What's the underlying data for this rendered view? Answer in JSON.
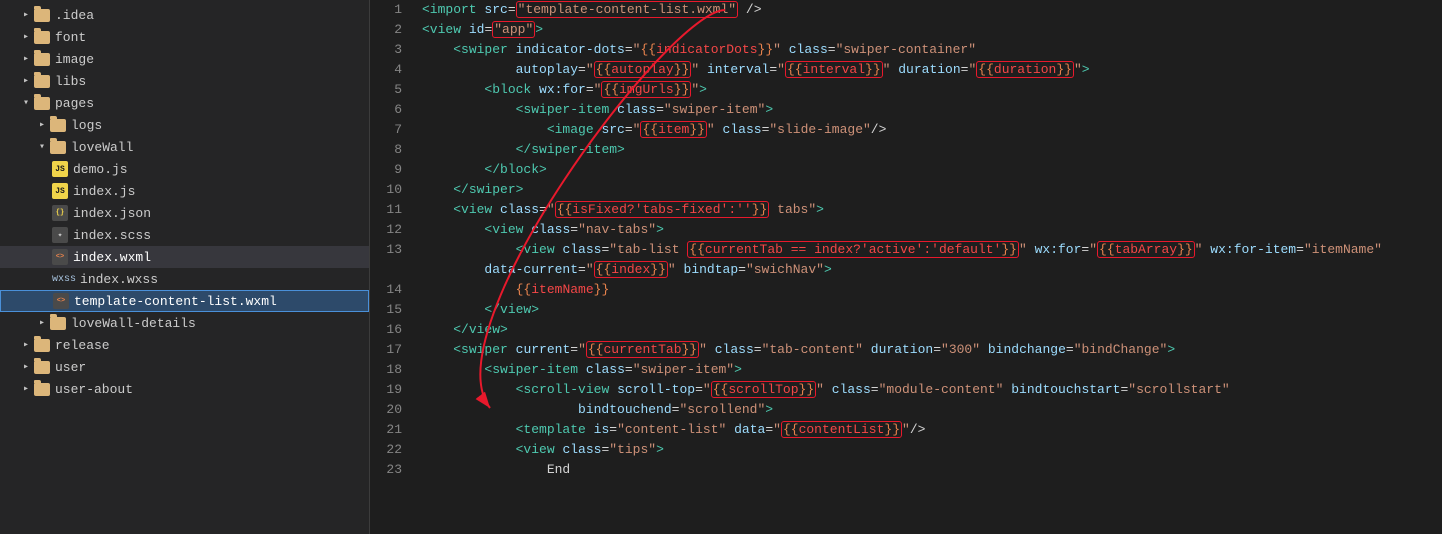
{
  "sidebar": {
    "items": [
      {
        "id": "idea",
        "label": ".idea",
        "type": "folder",
        "indent": 1,
        "open": false
      },
      {
        "id": "font",
        "label": "font",
        "type": "folder",
        "indent": 1,
        "open": false
      },
      {
        "id": "image",
        "label": "image",
        "type": "folder",
        "indent": 1,
        "open": false
      },
      {
        "id": "libs",
        "label": "libs",
        "type": "folder",
        "indent": 1,
        "open": false
      },
      {
        "id": "pages",
        "label": "pages",
        "type": "folder",
        "indent": 1,
        "open": true
      },
      {
        "id": "logs",
        "label": "logs",
        "type": "folder",
        "indent": 2,
        "open": false
      },
      {
        "id": "loveWall",
        "label": "loveWall",
        "type": "folder",
        "indent": 2,
        "open": true
      },
      {
        "id": "demo-js",
        "label": "demo.js",
        "type": "js",
        "indent": 3
      },
      {
        "id": "index-js",
        "label": "index.js",
        "type": "js",
        "indent": 3
      },
      {
        "id": "index-json",
        "label": "index.json",
        "type": "json",
        "indent": 3
      },
      {
        "id": "index-scss",
        "label": "index.scss",
        "type": "css",
        "indent": 3
      },
      {
        "id": "index-wxml",
        "label": "index.wxml",
        "type": "xml",
        "indent": 3,
        "active": true
      },
      {
        "id": "index-wxss",
        "label": "index.wxss",
        "type": "wxss",
        "indent": 3
      },
      {
        "id": "template-content-list-wxml",
        "label": "template-content-list.wxml",
        "type": "xml",
        "indent": 3,
        "highlighted": true
      },
      {
        "id": "loveWall-details",
        "label": "loveWall-details",
        "type": "folder",
        "indent": 2,
        "open": false
      },
      {
        "id": "release",
        "label": "release",
        "type": "folder",
        "indent": 1,
        "open": false
      },
      {
        "id": "user",
        "label": "user",
        "type": "folder",
        "indent": 1,
        "open": false
      },
      {
        "id": "user-about",
        "label": "user-about",
        "type": "folder",
        "indent": 1,
        "open": false
      }
    ]
  },
  "editor": {
    "lines": [
      {
        "num": 1,
        "html": "<span class='tag'>&lt;import</span> <span class='attr-name'>src</span>=<span class='attr-value circled'>\"template-content-list.wxml\"</span> <span class='bracket'>/&gt;</span>"
      },
      {
        "num": 2,
        "html": "<span class='tag'>&lt;view</span> <span class='attr-name'><span class='attr-id'>id</span></span>=<span class='attr-value circled'>\"app\"</span><span class='tag'>&gt;</span>"
      },
      {
        "num": 3,
        "html": "    <span class='tag'>&lt;swiper</span> <span class='attr-name'>indicator-dots</span>=<span class='attr-value'>\"<span class='template-brace'>{{</span><span class='template-expr'>indicatorDots</span><span class='template-brace'>}}</span>\"</span> <span class='attr-name'>class</span>=<span class='attr-value'>\"swiper-container\"</span>"
      },
      {
        "num": 4,
        "html": "            <span class='attr-name'>autoplay</span>=<span class='attr-value'>\"<span class='template-brace circled'>{{</span><span class='template-expr circled'>autoplay</span><span class='template-brace circled'>}}</span>\"</span> <span class='attr-name'>interval</span>=<span class='attr-value'>\"<span class='template-brace circled'>{{</span><span class='template-expr circled'>interval</span><span class='template-brace circled'>}}</span>\"</span> <span class='attr-name'>duration</span>=<span class='attr-value'>\"<span class='template-brace circled'>{{</span><span class='template-expr circled'>duration</span><span class='template-brace circled'>}}</span>\"</span><span class='tag'>&gt;</span>"
      },
      {
        "num": 5,
        "html": "        <span class='tag'>&lt;block</span> <span class='attr-name'>wx:for</span>=<span class='attr-value'>\"<span class='template-brace circled'>{{</span><span class='template-expr circled'>imgUrls</span><span class='template-brace circled'>}}</span>\"</span><span class='tag'>&gt;</span>"
      },
      {
        "num": 6,
        "html": "            <span class='tag'>&lt;swiper-item</span> <span class='attr-name'>class</span>=<span class='attr-value'>\"swiper-item\"</span><span class='tag'>&gt;</span>"
      },
      {
        "num": 7,
        "html": "                <span class='tag'>&lt;image</span> <span class='attr-name'>src</span>=<span class='attr-value'>\"<span class='template-brace circled'>{{</span><span class='template-expr circled'>item</span><span class='template-brace circled'>}}</span>\"</span> <span class='attr-name'>class</span>=<span class='attr-value'>\"slide-image\"</span><span class='bracket'>/&gt;</span>"
      },
      {
        "num": 8,
        "html": "            <span class='tag'>&lt;/swiper-item&gt;</span>"
      },
      {
        "num": 9,
        "html": "        <span class='tag'>&lt;/block&gt;</span>"
      },
      {
        "num": 10,
        "html": "    <span class='tag'>&lt;/swiper&gt;</span>"
      },
      {
        "num": 11,
        "html": "    <span class='tag'>&lt;view</span> <span class='attr-name'>class</span>=<span class='attr-value'>\"<span class='template-brace circled'>{{</span><span class='template-expr circled'>isFixed?'tabs-fixed':''</span><span class='template-brace circled'>}}</span> tabs\"</span><span class='tag'>&gt;</span>"
      },
      {
        "num": 12,
        "html": "        <span class='tag'>&lt;view</span> <span class='attr-name'>class</span>=<span class='attr-value'>\"nav-tabs\"</span><span class='tag'>&gt;</span>"
      },
      {
        "num": 13,
        "html": "            <span class='tag'>&lt;view</span> <span class='attr-name'>class</span>=<span class='attr-value'>\"tab-list <span class='template-brace circled'>{{</span><span class='template-expr circled'>currentTab == index?'active':'default'</span><span class='template-brace circled'>}}</span>\"</span> <span class='attr-name'>wx:for</span>=<span class='attr-value'>\"<span class='template-brace circled'>{{</span><span class='template-expr circled'>tabArray</span><span class='template-brace circled'>}}</span>\"</span> <span class='attr-name'>wx:for-item</span>=<span class='attr-value'>\"itemName\"</span>"
      },
      {
        "num": 13,
        "html": "        <span class='attr-name'>data-current</span>=<span class='attr-value'>\"<span class='template-brace circled'>{{</span><span class='template-expr circled'>index</span><span class='template-brace circled'>}}</span>\"</span> <span class='attr-name'>bindtap</span>=<span class='attr-value'>\"swichNav\"</span><span class='tag'>&gt;</span>"
      },
      {
        "num": 14,
        "html": "            <span class='template-brace'>{{</span><span class='template-expr'>itemName</span><span class='template-brace'>}}</span>"
      },
      {
        "num": 15,
        "html": "        <span class='tag'>&lt;/view&gt;</span>"
      },
      {
        "num": 16,
        "html": "    <span class='tag'>&lt;/view&gt;</span>"
      },
      {
        "num": 17,
        "html": "    <span class='tag'>&lt;swiper</span> <span class='attr-name'>current</span>=<span class='attr-value'>\"<span class='template-brace circled'>{{</span><span class='template-expr circled'>currentTab</span><span class='template-brace circled'>}}</span>\"</span> <span class='attr-name'>class</span>=<span class='attr-value'>\"tab-content\"</span> <span class='attr-name'>duration</span>=<span class='attr-value'>\"300\"</span> <span class='attr-name'>bindchange</span>=<span class='attr-value'>\"bindChange\"</span><span class='tag'>&gt;</span>"
      },
      {
        "num": 18,
        "html": "        <span class='tag'>&lt;swiper-item</span> <span class='attr-name'>class</span>=<span class='attr-value'>\"swiper-item\"</span><span class='tag'>&gt;</span>"
      },
      {
        "num": 19,
        "html": "            <span class='tag'>&lt;scroll-view</span> <span class='attr-name'>scroll-top</span>=<span class='attr-value'>\"<span class='template-brace circled'>{{</span><span class='template-expr circled'>scrollTop</span><span class='template-brace circled'>}}</span>\"</span> <span class='attr-name'>class</span>=<span class='attr-value'>\"module-content\"</span> <span class='attr-name'>bindtouchstart</span>=<span class='attr-value'>\"scrollstart\"</span>"
      },
      {
        "num": 20,
        "html": "                    <span class='attr-name'>bindtouchend</span>=<span class='attr-value'>\"scrollend\"</span><span class='tag'>&gt;</span>"
      },
      {
        "num": 21,
        "html": "            <span class='tag'>&lt;template</span> <span class='attr-name'>is</span>=<span class='attr-value'>\"content-list\"</span> <span class='attr-name'>data</span>=<span class='attr-value'>\"<span class='template-brace circled'>{{</span><span class='template-expr circled'>contentList</span><span class='template-brace circled'>}}</span>\"</span><span class='bracket'>/&gt;</span>"
      },
      {
        "num": 22,
        "html": "            <span class='tag'>&lt;view</span> <span class='attr-name'>class</span>=<span class='attr-value'>\"tips\"</span><span class='tag'>&gt;</span>"
      },
      {
        "num": 23,
        "html": "                <span class='text-content'>End</span>"
      }
    ]
  }
}
